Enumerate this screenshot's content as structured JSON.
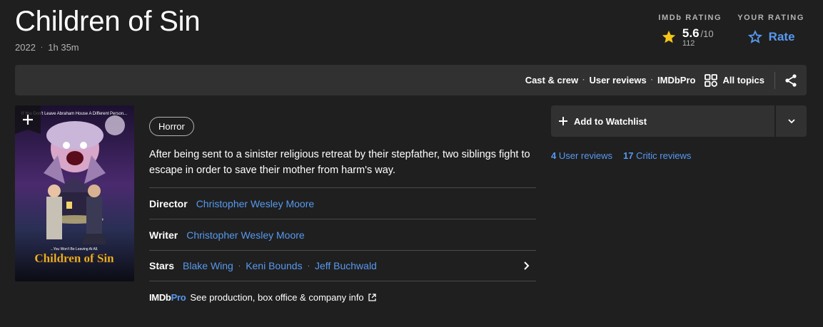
{
  "title": "Children of Sin",
  "meta": {
    "year": "2022",
    "runtime": "1h 35m"
  },
  "ratings": {
    "imdb_label": "IMDb RATING",
    "score": "5.6",
    "outof": "/10",
    "votes": "112",
    "your_label": "YOUR RATING",
    "rate_label": "Rate"
  },
  "nav": {
    "cast_crew": "Cast & crew",
    "user_reviews": "User reviews",
    "imdbpro": "IMDbPro",
    "all_topics": "All topics"
  },
  "poster": {
    "tagline": "If You Don't Leave Abraham House A Different Person...",
    "title": "Children of Sin",
    "sub": "...You Won't Be Leaving At All."
  },
  "genre": "Horror",
  "plot": "After being sent to a sinister religious retreat by their stepfather, two siblings fight to escape in order to save their mother from harm's way.",
  "credits": {
    "director_label": "Director",
    "director": "Christopher Wesley Moore",
    "writer_label": "Writer",
    "writer": "Christopher Wesley Moore",
    "stars_label": "Stars",
    "stars": [
      "Blake Wing",
      "Keni Bounds",
      "Jeff Buchwald"
    ]
  },
  "pro": {
    "logo_a": "IMDb",
    "logo_b": "Pro",
    "text": "See production, box office & company info"
  },
  "watchlist": {
    "label": "Add to Watchlist"
  },
  "reviews": {
    "user_count": "4",
    "user_label": "User reviews",
    "critic_count": "17",
    "critic_label": "Critic reviews"
  },
  "colors": {
    "accent": "#5799ef",
    "star": "#f5c518",
    "background": "#1f1f1f",
    "panel": "#313131"
  }
}
